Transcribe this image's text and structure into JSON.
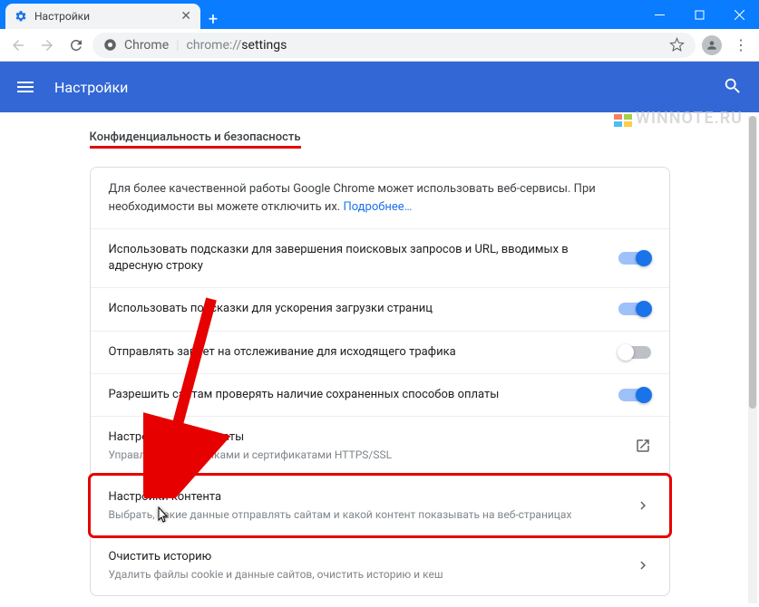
{
  "tab": {
    "title": "Настройки"
  },
  "omnibox": {
    "origin": "Chrome",
    "path_prefix": "chrome://",
    "path": "settings"
  },
  "app": {
    "title": "Настройки"
  },
  "section": {
    "title": "Конфиденциальность и безопасность"
  },
  "intro": {
    "text": "Для более качественной работы Google Chrome может использовать веб-сервисы. При необходимости вы можете отключить их. ",
    "link": "Подробнее…"
  },
  "rows": {
    "autocomplete": {
      "title": "Использовать подсказки для завершения поисковых запросов и URL, вводимых в адресную строку",
      "on": true
    },
    "prefetch": {
      "title": "Использовать подсказки для ускорения загрузки страниц",
      "on": true
    },
    "dnt": {
      "title": "Отправлять запрет на отслеживание для исходящего трафика",
      "on": false
    },
    "payment": {
      "title": "Разрешить сайтам проверять наличие сохраненных способов оплаты",
      "on": true
    },
    "certs": {
      "title": "Настроить сертификаты",
      "sub": "Управление настройками и сертификатами HTTPS/SSL"
    },
    "content": {
      "title": "Настройки контента",
      "sub": "Выбрать, какие данные отправлять сайтам и какой контент показывать на веб-страницах"
    },
    "clear": {
      "title": "Очистить историю",
      "sub": "Удалить файлы cookie и данные сайтов, очистить историю и кеш"
    }
  },
  "watermark": "WINNOTE.RU"
}
